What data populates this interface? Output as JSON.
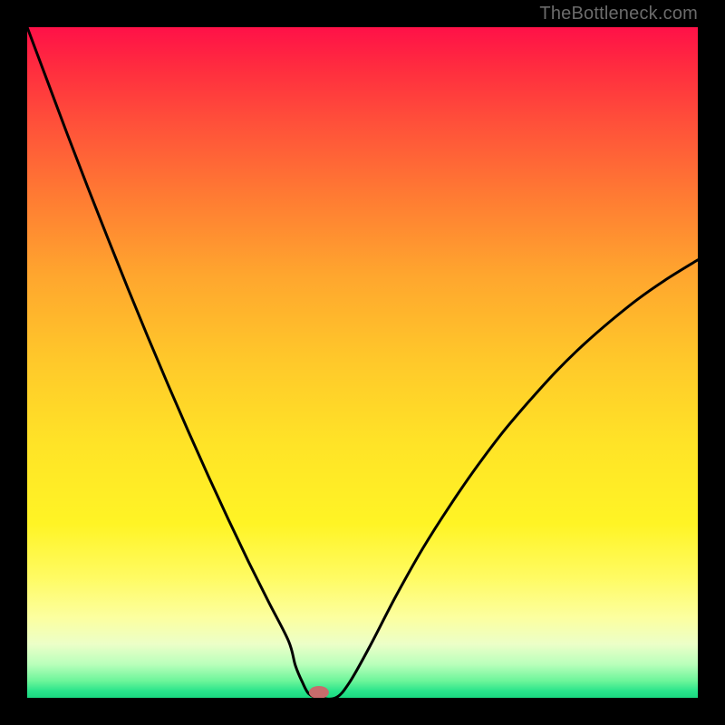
{
  "watermark": {
    "text": "TheBottleneck.com"
  },
  "chart_data": {
    "type": "line",
    "title": "",
    "xlabel": "",
    "ylabel": "",
    "xlim": [
      0,
      1
    ],
    "ylim": [
      0,
      1
    ],
    "gradient_stops": [
      {
        "t": 0.0,
        "color": "#ff1148"
      },
      {
        "t": 0.06,
        "color": "#ff2c3f"
      },
      {
        "t": 0.14,
        "color": "#ff4f3a"
      },
      {
        "t": 0.25,
        "color": "#ff7a33"
      },
      {
        "t": 0.37,
        "color": "#ffa62e"
      },
      {
        "t": 0.5,
        "color": "#ffc92a"
      },
      {
        "t": 0.62,
        "color": "#ffe327"
      },
      {
        "t": 0.74,
        "color": "#fff425"
      },
      {
        "t": 0.82,
        "color": "#fffb62"
      },
      {
        "t": 0.88,
        "color": "#fcff9f"
      },
      {
        "t": 0.92,
        "color": "#ecffc8"
      },
      {
        "t": 0.95,
        "color": "#b9ffbb"
      },
      {
        "t": 0.975,
        "color": "#6cf59a"
      },
      {
        "t": 0.99,
        "color": "#29e48b"
      },
      {
        "t": 1.0,
        "color": "#1ad880"
      }
    ],
    "series": [
      {
        "name": "curve",
        "x": [
          0.0,
          0.03,
          0.06,
          0.09,
          0.12,
          0.15,
          0.18,
          0.21,
          0.24,
          0.27,
          0.3,
          0.33,
          0.36,
          0.39,
          0.4,
          0.41,
          0.42,
          0.435,
          0.46,
          0.48,
          0.51,
          0.55,
          0.59,
          0.63,
          0.67,
          0.71,
          0.75,
          0.79,
          0.83,
          0.87,
          0.91,
          0.95,
          1.0
        ],
        "y": [
          1.0,
          0.92,
          0.84,
          0.762,
          0.686,
          0.611,
          0.538,
          0.467,
          0.398,
          0.331,
          0.266,
          0.203,
          0.143,
          0.084,
          0.048,
          0.024,
          0.006,
          0.0,
          0.0,
          0.022,
          0.075,
          0.152,
          0.223,
          0.286,
          0.344,
          0.397,
          0.444,
          0.488,
          0.527,
          0.562,
          0.594,
          0.622,
          0.653
        ]
      }
    ],
    "marker": {
      "x": 0.435,
      "y": 0.0,
      "color": "#c76c6c"
    }
  }
}
